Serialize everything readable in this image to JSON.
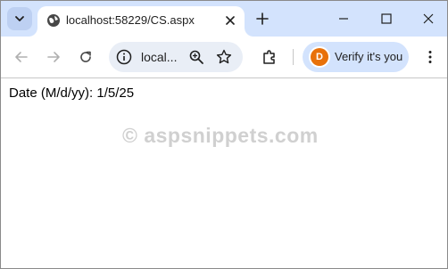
{
  "browser": {
    "tab": {
      "title": "localhost:58229/CS.aspx",
      "favicon": "globe-icon"
    },
    "omnibox": {
      "url_display": "local..."
    },
    "profile": {
      "avatar_letter": "D",
      "label": "Verify it's you",
      "avatar_color": "#e8710a"
    },
    "colors": {
      "tabstrip": "#d3e3fd",
      "omnibox_bg": "#e9eef6"
    }
  },
  "page": {
    "date_line": "Date (M/d/yy): 1/5/25",
    "watermark": "© aspsnippets.com"
  }
}
